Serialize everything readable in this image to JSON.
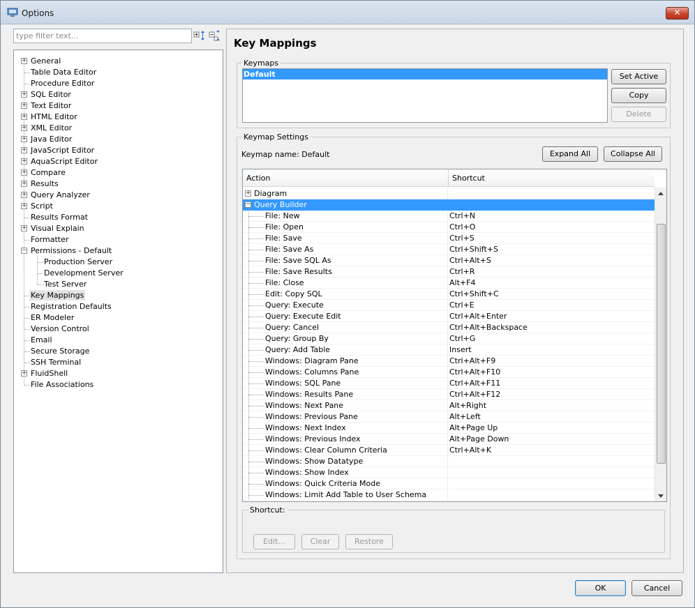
{
  "window": {
    "title": "Options",
    "close_label": "✕"
  },
  "filter": {
    "placeholder": "type filter text..."
  },
  "tree": {
    "items": [
      {
        "label": "General",
        "expandable": true,
        "level": 0
      },
      {
        "label": "Table Data Editor",
        "expandable": false,
        "level": 0
      },
      {
        "label": "Procedure Editor",
        "expandable": false,
        "level": 0
      },
      {
        "label": "SQL Editor",
        "expandable": true,
        "level": 0
      },
      {
        "label": "Text Editor",
        "expandable": true,
        "level": 0
      },
      {
        "label": "HTML Editor",
        "expandable": true,
        "level": 0
      },
      {
        "label": "XML Editor",
        "expandable": true,
        "level": 0
      },
      {
        "label": "Java Editor",
        "expandable": true,
        "level": 0
      },
      {
        "label": "JavaScript Editor",
        "expandable": true,
        "level": 0
      },
      {
        "label": "AquaScript Editor",
        "expandable": true,
        "level": 0
      },
      {
        "label": "Compare",
        "expandable": true,
        "level": 0
      },
      {
        "label": "Results",
        "expandable": true,
        "level": 0
      },
      {
        "label": "Query Analyzer",
        "expandable": true,
        "level": 0
      },
      {
        "label": "Script",
        "expandable": true,
        "level": 0
      },
      {
        "label": "Results Format",
        "expandable": false,
        "level": 0
      },
      {
        "label": "Visual Explain",
        "expandable": true,
        "level": 0
      },
      {
        "label": "Formatter",
        "expandable": false,
        "level": 0
      },
      {
        "label": "Permissions - Default",
        "expandable": true,
        "expanded": true,
        "level": 0
      },
      {
        "label": "Production Server",
        "expandable": false,
        "level": 1
      },
      {
        "label": "Development Server",
        "expandable": false,
        "level": 1
      },
      {
        "label": "Test Server",
        "expandable": false,
        "level": 1
      },
      {
        "label": "Key Mappings",
        "expandable": false,
        "level": 0,
        "selected": true
      },
      {
        "label": "Registration Defaults",
        "expandable": false,
        "level": 0
      },
      {
        "label": "ER Modeler",
        "expandable": false,
        "level": 0
      },
      {
        "label": "Version Control",
        "expandable": false,
        "level": 0
      },
      {
        "label": "Email",
        "expandable": false,
        "level": 0
      },
      {
        "label": "Secure Storage",
        "expandable": false,
        "level": 0
      },
      {
        "label": "SSH Terminal",
        "expandable": false,
        "level": 0
      },
      {
        "label": "FluidShell",
        "expandable": true,
        "level": 0
      },
      {
        "label": "File Associations",
        "expandable": false,
        "level": 0
      }
    ]
  },
  "main": {
    "title": "Key Mappings",
    "keymaps": {
      "group_label": "Keymaps",
      "items": [
        "Default"
      ],
      "set_active_label": "Set Active",
      "copy_label": "Copy",
      "delete_label": "Delete"
    },
    "settings": {
      "group_label": "Keymap Settings",
      "keymap_name": "Keymap name: Default",
      "expand_all_label": "Expand All",
      "collapse_all_label": "Collapse All",
      "columns": [
        "Action",
        "Shortcut"
      ],
      "groups": [
        {
          "label": "Diagram",
          "expanded": false
        },
        {
          "label": "Query Builder",
          "expanded": true,
          "selected": true
        }
      ],
      "rows": [
        {
          "action": "File: New",
          "shortcut": "Ctrl+N"
        },
        {
          "action": "File: Open",
          "shortcut": "Ctrl+O"
        },
        {
          "action": "File: Save",
          "shortcut": "Ctrl+S"
        },
        {
          "action": "File: Save As",
          "shortcut": "Ctrl+Shift+S"
        },
        {
          "action": "File: Save SQL As",
          "shortcut": "Ctrl+Alt+S"
        },
        {
          "action": "File: Save Results",
          "shortcut": "Ctrl+R"
        },
        {
          "action": "File: Close",
          "shortcut": "Alt+F4"
        },
        {
          "action": "Edit: Copy SQL",
          "shortcut": "Ctrl+Shift+C"
        },
        {
          "action": "Query: Execute",
          "shortcut": "Ctrl+E"
        },
        {
          "action": "Query: Execute Edit",
          "shortcut": "Ctrl+Alt+Enter"
        },
        {
          "action": "Query: Cancel",
          "shortcut": "Ctrl+Alt+Backspace"
        },
        {
          "action": "Query: Group By",
          "shortcut": "Ctrl+G"
        },
        {
          "action": "Query: Add Table",
          "shortcut": "Insert"
        },
        {
          "action": "Windows: Diagram Pane",
          "shortcut": "Ctrl+Alt+F9"
        },
        {
          "action": "Windows: Columns Pane",
          "shortcut": "Ctrl+Alt+F10"
        },
        {
          "action": "Windows: SQL Pane",
          "shortcut": "Ctrl+Alt+F11"
        },
        {
          "action": "Windows: Results Pane",
          "shortcut": "Ctrl+Alt+F12"
        },
        {
          "action": "Windows: Next Pane",
          "shortcut": "Alt+Right"
        },
        {
          "action": "Windows: Previous Pane",
          "shortcut": "Alt+Left"
        },
        {
          "action": "Windows: Next Index",
          "shortcut": "Alt+Page Up"
        },
        {
          "action": "Windows: Previous Index",
          "shortcut": "Alt+Page Down"
        },
        {
          "action": "Windows: Clear Column Criteria",
          "shortcut": "Ctrl+Alt+K"
        },
        {
          "action": "Windows: Show Datatype",
          "shortcut": ""
        },
        {
          "action": "Windows: Show Index",
          "shortcut": ""
        },
        {
          "action": "Windows: Quick Criteria Mode",
          "shortcut": ""
        },
        {
          "action": "Windows: Limit Add Table to User Schema",
          "shortcut": ""
        }
      ]
    },
    "shortcut": {
      "group_label": "Shortcut:",
      "edit_label": "Edit...",
      "clear_label": "Clear",
      "restore_label": "Restore"
    }
  },
  "footer": {
    "ok_label": "OK",
    "cancel_label": "Cancel"
  },
  "colors": {
    "selection": "#3399ff",
    "titlebar": "#c9d6e5",
    "close": "#c9432b"
  }
}
